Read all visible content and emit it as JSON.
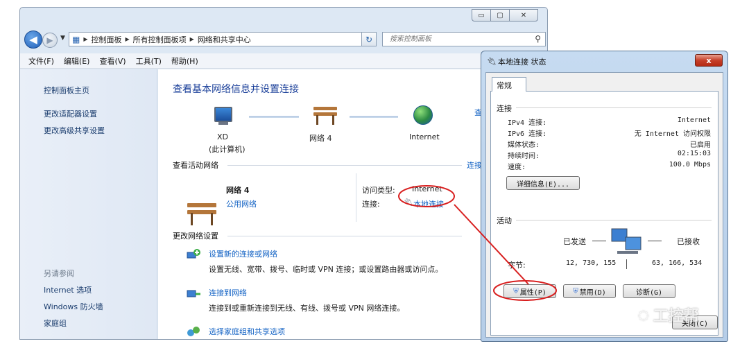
{
  "nav": {
    "breadcrumbs": [
      "控制面板",
      "所有控制面板项",
      "网络和共享中心"
    ],
    "search_placeholder": "搜索控制面板"
  },
  "menu": [
    "文件(F)",
    "编辑(E)",
    "查看(V)",
    "工具(T)",
    "帮助(H)"
  ],
  "left_pane": {
    "links": [
      "控制面板主页",
      "更改适配器设置",
      "更改高级共享设置"
    ],
    "see_also_title": "另请参阅",
    "see_also": [
      "Internet 选项",
      "Windows 防火墙",
      "家庭组"
    ]
  },
  "content": {
    "heading": "查看基本网络信息并设置连接",
    "map": {
      "computer_name": "XD",
      "computer_sub": "(此计算机)",
      "network_name": "网络 4",
      "internet": "Internet",
      "map_link_partial": "查",
      "connect_link_partial": "连接"
    },
    "active_title": "查看活动网络",
    "active": {
      "name": "网络 4",
      "type": "公用网络",
      "access_label": "访问类型:",
      "access_value": "Internet",
      "conn_label": "连接:",
      "conn_value": "本地连接"
    },
    "change_title": "更改网络设置",
    "tasks": [
      {
        "title": "设置新的连接或网络",
        "desc": "设置无线、宽带、拨号、临时或 VPN 连接；或设置路由器或访问点。"
      },
      {
        "title": "连接到网络",
        "desc": "连接到或重新连接到无线、有线、拨号或 VPN 网络连接。"
      },
      {
        "title": "选择家庭组和共享选项",
        "desc": ""
      }
    ]
  },
  "dialog": {
    "title": "本地连接 状态",
    "close": "x",
    "tab": "常规",
    "conn_group": "连接",
    "rows": [
      {
        "key": "IPv4 连接:",
        "value": "Internet"
      },
      {
        "key": "IPv6 连接:",
        "value": "无 Internet 访问权限"
      },
      {
        "key": "媒体状态:",
        "value": "已启用"
      },
      {
        "key": "持续时间:",
        "value": "02:15:03"
      },
      {
        "key": "速度:",
        "value": "100.0 Mbps"
      }
    ],
    "details_button": "详细信息(E)...",
    "activity_group": "活动",
    "sent_label": "已发送",
    "recv_label": "已接收",
    "bytes_label": "字节:",
    "bytes_sent": "12, 730, 155",
    "bytes_recv": "63, 166, 534",
    "properties_button": "属性(P)",
    "disable_button": "禁用(D)",
    "diagnose_button": "诊断(G)",
    "close_button_partial": "关闭(C)"
  },
  "watermark": "工控帮",
  "colors": {
    "annotation": "#d81e1e",
    "link": "#1262c4",
    "heading": "#1a3f99"
  }
}
